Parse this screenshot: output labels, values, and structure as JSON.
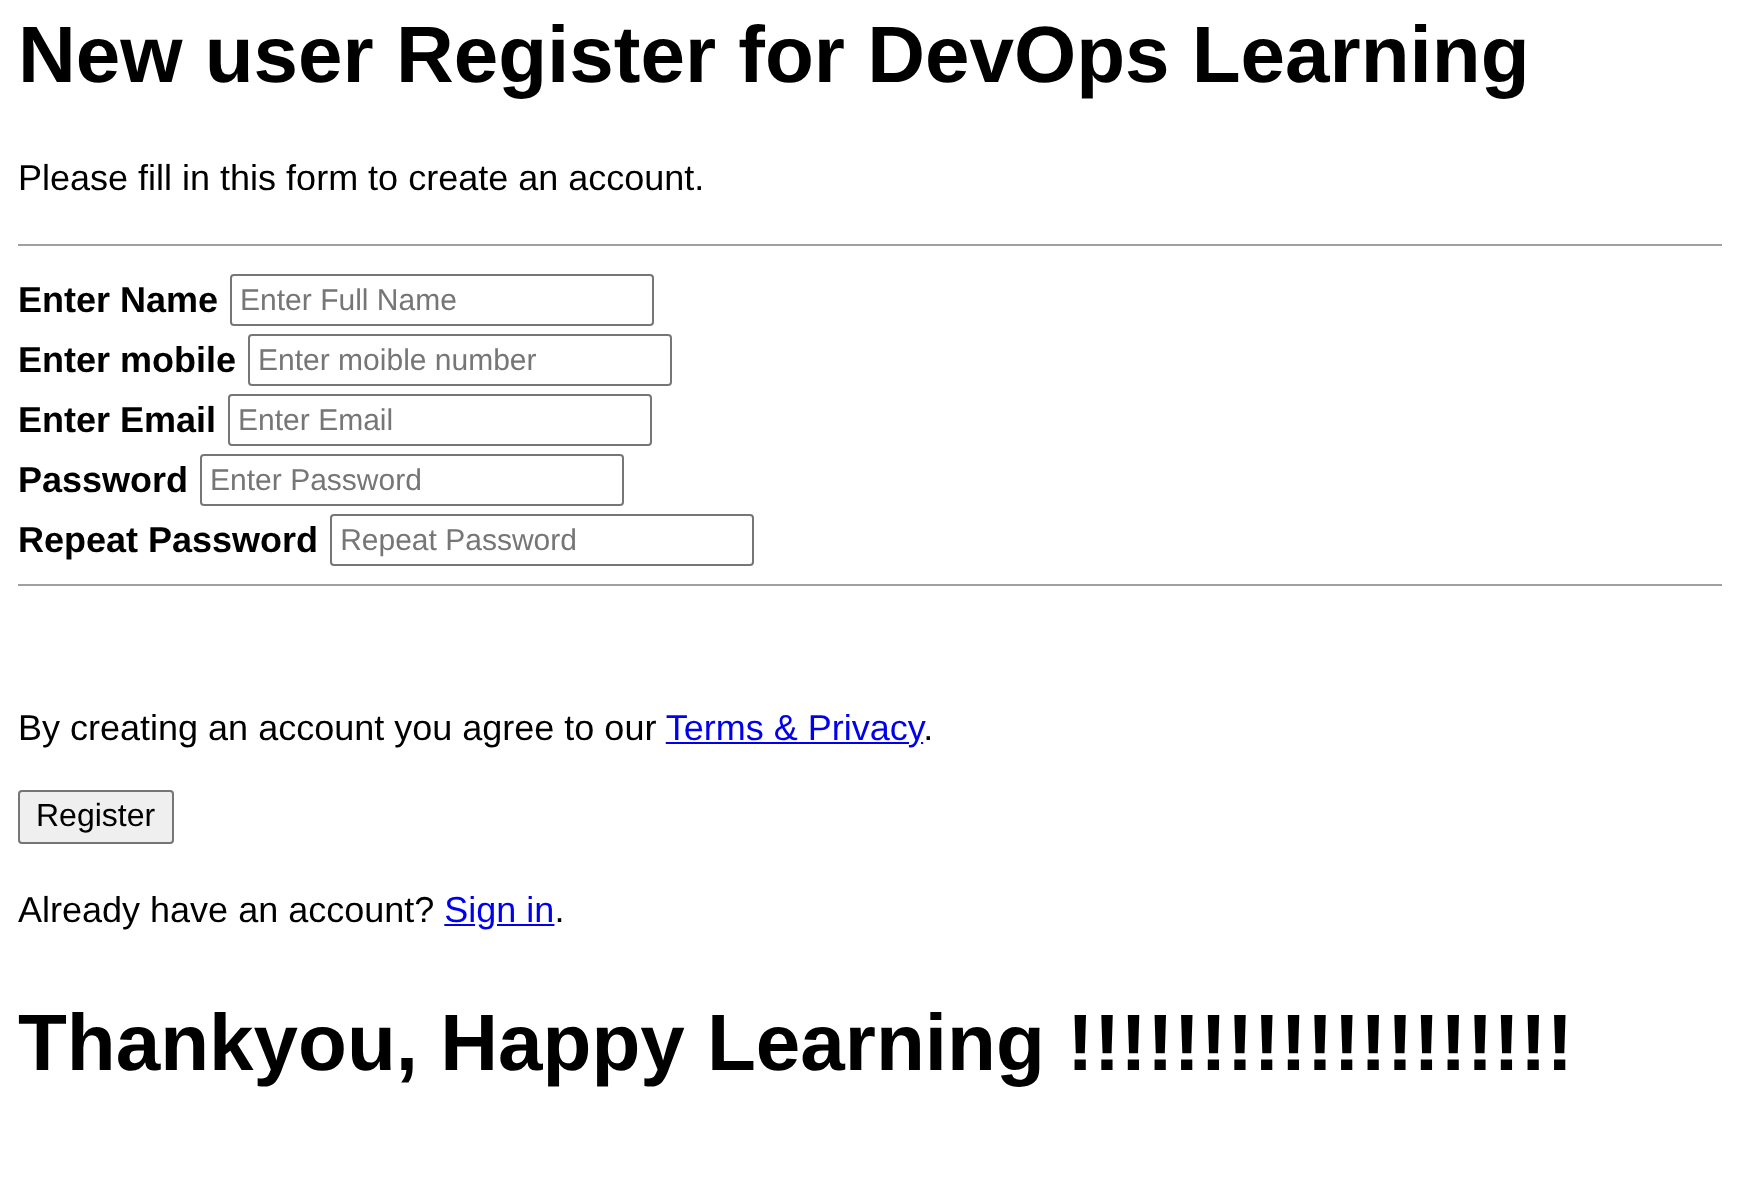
{
  "title": "New user Register for DevOps Learning",
  "intro": "Please fill in this form to create an account.",
  "fields": [
    {
      "label": "Enter Name",
      "placeholder": "Enter Full Name"
    },
    {
      "label": "Enter mobile",
      "placeholder": "Enter moible number"
    },
    {
      "label": "Enter Email",
      "placeholder": "Enter Email"
    },
    {
      "label": "Password",
      "placeholder": "Enter Password"
    },
    {
      "label": "Repeat Password",
      "placeholder": "Repeat Password"
    }
  ],
  "agreement": {
    "text": "By creating an account you agree to our ",
    "link": "Terms & Privacy",
    "end": "."
  },
  "register_button": "Register",
  "signin": {
    "text": "Already have an account? ",
    "link": "Sign in",
    "end": "."
  },
  "footer": "Thankyou, Happy Learning !!!!!!!!!!!!!!!!!!!"
}
